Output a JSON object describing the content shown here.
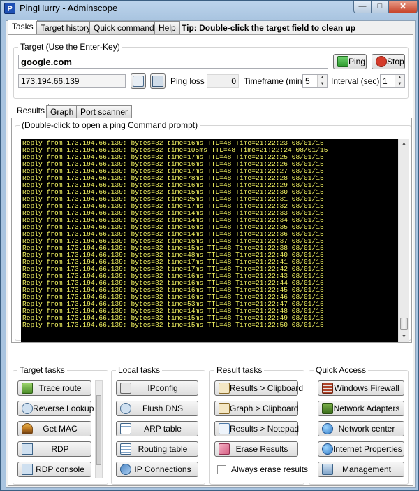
{
  "window": {
    "title": "PingHurry - Adminscope",
    "app_icon_glyph": "P",
    "min_glyph": "—",
    "max_glyph": "□",
    "close_glyph": "✕"
  },
  "main_tabs": [
    "Tasks",
    "Target history",
    "Quick commands",
    "Help"
  ],
  "tip": "Tip: Double-click the target field to clean up",
  "target": {
    "group_label": "Target (Use the Enter-Key)",
    "value": "google.com",
    "ping_label": "Ping",
    "stop_label": "Stop",
    "ip": "173.194.66.139",
    "ping_loss_label": "Ping loss",
    "ping_loss_value": "0",
    "timeframe_label": "Timeframe (min)",
    "timeframe_value": "5",
    "interval_label": "Interval (sec)",
    "interval_value": "1"
  },
  "results_tabs": [
    "Results",
    "Graph",
    "Port scanner"
  ],
  "results_hint": "(Double-click to open a ping Command prompt)",
  "ping_lines": [
    "Reply from 173.194.66.139: bytes=32 time=16ms TTL=48 Time=21:22:23 08/01/15",
    "Reply from 173.194.66.139: bytes=32 time=105ms TTL=48 Time=21:22:24 08/01/15",
    "Reply from 173.194.66.139: bytes=32 time=17ms TTL=48 Time=21:22:25 08/01/15",
    "Reply from 173.194.66.139: bytes=32 time=16ms TTL=48 Time=21:22:26 08/01/15",
    "Reply from 173.194.66.139: bytes=32 time=17ms TTL=48 Time=21:22:27 08/01/15",
    "Reply from 173.194.66.139: bytes=32 time=78ms TTL=48 Time=21:22:28 08/01/15",
    "Reply from 173.194.66.139: bytes=32 time=16ms TTL=48 Time=21:22:29 08/01/15",
    "Reply from 173.194.66.139: bytes=32 time=15ms TTL=48 Time=21:22:30 08/01/15",
    "Reply from 173.194.66.139: bytes=32 time=25ms TTL=48 Time=21:22:31 08/01/15",
    "Reply from 173.194.66.139: bytes=32 time=17ms TTL=48 Time=21:22:32 08/01/15",
    "Reply from 173.194.66.139: bytes=32 time=14ms TTL=48 Time=21:22:33 08/01/15",
    "Reply from 173.194.66.139: bytes=32 time=14ms TTL=48 Time=21:22:34 08/01/15",
    "Reply from 173.194.66.139: bytes=32 time=16ms TTL=48 Time=21:22:35 08/01/15",
    "Reply from 173.194.66.139: bytes=32 time=14ms TTL=48 Time=21:22:36 08/01/15",
    "Reply from 173.194.66.139: bytes=32 time=16ms TTL=48 Time=21:22:37 08/01/15",
    "Reply from 173.194.66.139: bytes=32 time=15ms TTL=48 Time=21:22:38 08/01/15",
    "Reply from 173.194.66.139: bytes=32 time=48ms TTL=48 Time=21:22:40 08/01/15",
    "Reply from 173.194.66.139: bytes=32 time=17ms TTL=48 Time=21:22:41 08/01/15",
    "Reply from 173.194.66.139: bytes=32 time=17ms TTL=48 Time=21:22:42 08/01/15",
    "Reply from 173.194.66.139: bytes=32 time=16ms TTL=48 Time=21:22:43 08/01/15",
    "Reply from 173.194.66.139: bytes=32 time=16ms TTL=48 Time=21:22:44 08/01/15",
    "Reply from 173.194.66.139: bytes=32 time=16ms TTL=48 Time=21:22:45 08/01/15",
    "Reply from 173.194.66.139: bytes=32 time=16ms TTL=48 Time=21:22:46 08/01/15",
    "Reply from 173.194.66.139: bytes=32 time=53ms TTL=48 Time=21:22:47 08/01/15",
    "Reply from 173.194.66.139: bytes=32 time=14ms TTL=48 Time=21:22:48 08/01/15",
    "Reply from 173.194.66.139: bytes=32 time=15ms TTL=48 Time=21:22:49 08/01/15",
    "Reply from 173.194.66.139: bytes=32 time=15ms TTL=48 Time=21:22:50 08/01/15"
  ],
  "target_tasks": {
    "label": "Target tasks",
    "buttons": [
      "Trace route",
      "Reverse Lookup",
      "Get MAC",
      "RDP",
      "RDP console"
    ]
  },
  "local_tasks": {
    "label": "Local tasks",
    "buttons": [
      "IPconfig",
      "Flush DNS",
      "ARP table",
      "Routing table",
      "IP Connections"
    ]
  },
  "result_tasks": {
    "label": "Result tasks",
    "buttons": [
      "Results > Clipboard",
      "Graph > Clipboard",
      "Results > Notepad",
      "Erase Results"
    ],
    "checkbox_label": "Always erase results"
  },
  "quick_access": {
    "label": "Quick Access",
    "buttons": [
      "Windows Firewall",
      "Network Adapters",
      "Network center",
      "Internet Properties",
      "Management"
    ]
  },
  "colors": {
    "console_bg": "#000000",
    "console_text": "#f5f562",
    "title_bar": "#a9c4e0"
  }
}
